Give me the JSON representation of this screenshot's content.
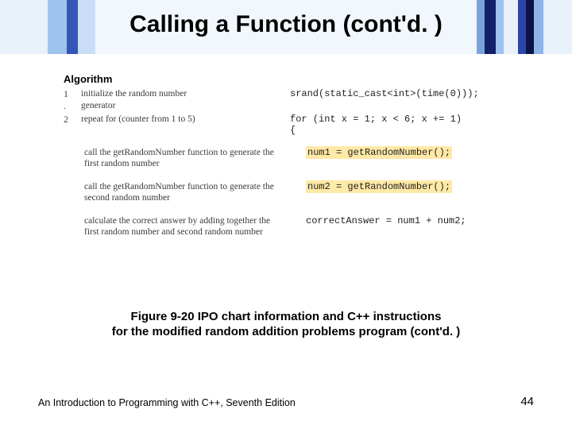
{
  "title": "Calling a Function (cont'd. )",
  "algorithm_header": "Algorithm",
  "steps": {
    "s1": {
      "num": "1",
      "text": "initialize the random number"
    },
    "s1b": {
      "num": ".",
      "text": "generator"
    },
    "s2": {
      "num": "2",
      "text": "repeat for (counter from 1 to 5)"
    }
  },
  "pseudo_blocks": {
    "p1": "call the getRandomNumber function to generate the first random number",
    "p2": "call the getRandomNumber function to generate the second random number",
    "p3": "calculate the correct answer by adding together the first random number and second random number"
  },
  "code": {
    "srand": "srand(static_cast<int>(time(0)));",
    "for": "for (int x = 1; x < 6; x += 1)",
    "lbrace": "{",
    "num1": "num1 = getRandomNumber();",
    "num2": "num2 = getRandomNumber();",
    "corr": "correctAnswer = num1 + num2;"
  },
  "caption_line1": "Figure 9-20 IPO chart information and C++ instructions",
  "caption_line2": "for the modified random addition problems program (cont'd. )",
  "footer_left": "An Introduction to Programming with C++, Seventh Edition",
  "page_number": "44",
  "bar_colors": [
    "#e6f0fb",
    "#b9d4f2",
    "#7fa9e0",
    "#3a5fbf",
    "#1a2f80",
    "#0c1850",
    "#7fa9e0",
    "#b9d4f2",
    "#e6f0fb",
    "#9cc1ef",
    "#3a5fbf",
    "#e6f0fb"
  ]
}
